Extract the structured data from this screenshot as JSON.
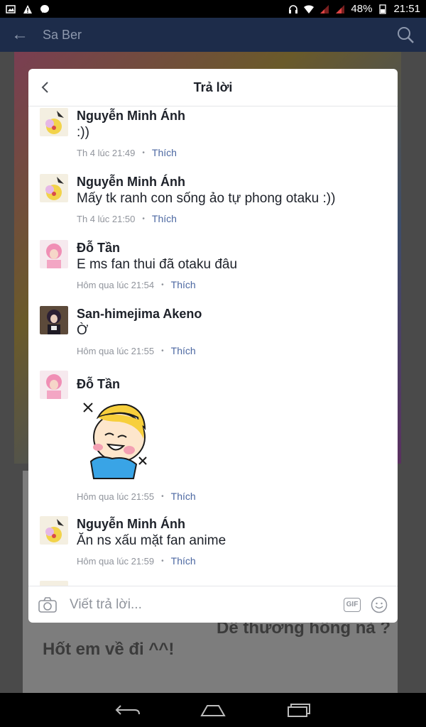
{
  "status": {
    "battery": "48%",
    "time": "21:51"
  },
  "appbar": {
    "title": "Sa Ber"
  },
  "background": {
    "text1": "Dễ thương hông nà ?",
    "text2": "Hốt em về đi ^^!"
  },
  "dialog": {
    "title": "Trả lời",
    "like_label": "Thích",
    "comments": [
      {
        "name": "Nguyễn Minh Ánh",
        "text": ":))",
        "time": "Th 4 lúc 21:49"
      },
      {
        "name": "Nguyễn Minh Ánh",
        "text": "Mấy tk ranh con sống ảo tự phong otaku :))",
        "time": "Th 4 lúc 21:50"
      },
      {
        "name": "Đỗ Tần",
        "text": "E ms fan thui đã otaku đâu",
        "time": "Hôm qua lúc 21:54"
      },
      {
        "name": "San-himejima Akeno",
        "text": "Ờ",
        "time": "Hôm qua lúc 21:55"
      },
      {
        "name": "Đỗ Tần",
        "text": "",
        "time": "Hôm qua lúc 21:55"
      },
      {
        "name": "Nguyễn Minh Ánh",
        "text": "Ăn ns xấu mặt fan anime",
        "time": "Hôm qua lúc 21:59"
      }
    ],
    "composer": {
      "placeholder": "Viết trả lời...",
      "gif_label": "GIF"
    }
  }
}
